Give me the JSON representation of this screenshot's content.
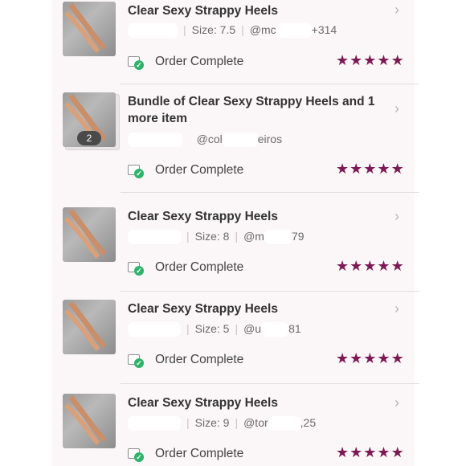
{
  "status_label": "Order Complete",
  "rating_stars": 5,
  "colors": {
    "star": "#7d1a55",
    "check": "#2eb36a"
  },
  "orders": [
    {
      "title": "Clear Sexy Strappy Heels",
      "size": "Size: 7.5",
      "user_prefix": "@mc",
      "user_suffix": "+314"
    },
    {
      "title": "Bundle of Clear Sexy Strappy Heels and 1 more item",
      "bundle_count": "2",
      "user_prefix": "@col",
      "user_suffix": "eiros"
    },
    {
      "title": "Clear Sexy Strappy Heels",
      "size": "Size: 8",
      "user_prefix": "@m",
      "user_suffix": "79"
    },
    {
      "title": "Clear Sexy Strappy Heels",
      "size": "Size: 5",
      "user_prefix": "@u",
      "user_suffix": "81"
    },
    {
      "title": "Clear Sexy Strappy Heels",
      "size": "Size: 9",
      "user_prefix": "@tor",
      "user_suffix": ",25"
    }
  ],
  "icons": {
    "chevron": "chevron-right-icon",
    "status": "order-complete-icon",
    "star": "star-icon"
  }
}
